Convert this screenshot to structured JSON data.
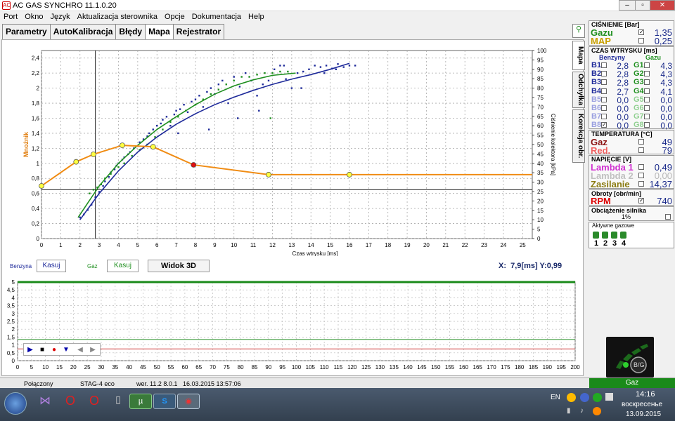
{
  "window": {
    "title": "AC GAS SYNCHRO  11.1.0.20",
    "icon_text": "AC"
  },
  "menu": [
    "Port",
    "Okno",
    "Język",
    "Aktualizacja sterownika",
    "Opcje",
    "Dokumentacja",
    "Help"
  ],
  "tabs": [
    "Parametry",
    "AutoKalibracja",
    "Błędy",
    "Mapa",
    "Rejestrator"
  ],
  "active_tab": "Mapa",
  "vtabs": [
    "Mapa",
    "Odchyłka",
    "Korekcja obr."
  ],
  "map_chart": {
    "ylabel_left": "Mnożnik",
    "ylabel_right": "Ciśnienie kolektora [kPa]",
    "xlabel": "Czas wtrysku [ms]",
    "y_ticks": [
      "0",
      "0,2",
      "0,4",
      "0,6",
      "0,8",
      "1",
      "1,2",
      "1,4",
      "1,6",
      "1,8",
      "2",
      "2,2",
      "2,4"
    ],
    "y2_ticks": [
      "0",
      "5",
      "10",
      "15",
      "20",
      "25",
      "30",
      "35",
      "40",
      "45",
      "50",
      "55",
      "60",
      "65",
      "70",
      "75",
      "80",
      "85",
      "90",
      "95",
      "100"
    ],
    "x_ticks": [
      "0",
      "1",
      "2",
      "3",
      "4",
      "5",
      "6",
      "7",
      "8",
      "9",
      "10",
      "11",
      "12",
      "13",
      "14",
      "15",
      "16",
      "17",
      "18",
      "19",
      "20",
      "21",
      "22",
      "23",
      "24",
      "25"
    ]
  },
  "chart_data": [
    {
      "type": "scatter",
      "xlabel": "Czas wtrysku [ms]",
      "ylabel": "Mnożnik",
      "y2label": "Ciśnienie kolektora [kPa]",
      "xlim": [
        0,
        25.5
      ],
      "ylim": [
        0,
        2.5
      ],
      "y2lim": [
        0,
        100
      ],
      "grid": true,
      "cursor": {
        "x": 2.8,
        "y": 0.65
      },
      "series": [
        {
          "name": "Benzyna",
          "color": "#1e2a9a",
          "kind": "points",
          "x": [
            2.0,
            2.2,
            2.4,
            2.6,
            2.8,
            3.0,
            3.2,
            3.3,
            3.5,
            3.6,
            3.8,
            3.9,
            4.0,
            4.2,
            4.3,
            4.5,
            4.6,
            4.8,
            5.0,
            5.1,
            5.3,
            5.5,
            5.6,
            5.8,
            6.0,
            6.2,
            6.3,
            6.5,
            6.7,
            6.9,
            7.0,
            7.2,
            7.4,
            7.6,
            7.8,
            8.0,
            8.2,
            8.4,
            8.6,
            8.8,
            9.0,
            9.2,
            9.4,
            9.7,
            10.0,
            10.3,
            10.6,
            10.9,
            11.2,
            11.5,
            11.8,
            12.1,
            12.4,
            12.7,
            13.0,
            13.3,
            13.6,
            13.9,
            14.2,
            14.5,
            14.8,
            15.1,
            15.4,
            15.7,
            16.0,
            16.3,
            7.1,
            8.7,
            10.2,
            11.3,
            12.6,
            13.5,
            14.7,
            15.3
          ],
          "y": [
            0.28,
            0.32,
            0.38,
            0.45,
            0.55,
            0.62,
            0.7,
            0.76,
            0.82,
            0.88,
            0.92,
            0.97,
            1.0,
            1.05,
            1.08,
            1.12,
            1.15,
            1.2,
            1.23,
            1.28,
            1.32,
            1.36,
            1.4,
            1.45,
            1.5,
            1.53,
            1.58,
            1.62,
            1.5,
            1.65,
            1.7,
            1.72,
            1.78,
            1.68,
            1.82,
            1.85,
            1.9,
            1.75,
            1.95,
            2.0,
            1.92,
            2.05,
            2.1,
            1.8,
            2.15,
            2.02,
            2.2,
            2.1,
            1.9,
            2.05,
            2.1,
            2.25,
            2.3,
            2.12,
            2.0,
            2.2,
            2.22,
            2.25,
            2.3,
            2.28,
            2.3,
            2.26,
            2.32,
            2.28,
            2.3,
            2.3,
            1.4,
            1.45,
            1.6,
            1.7,
            2.3,
            2.0,
            2.2,
            2.25
          ]
        },
        {
          "name": "Gaz",
          "color": "#1f8f1f",
          "kind": "points",
          "x": [
            2.5,
            2.7,
            2.9,
            3.1,
            3.3,
            3.6,
            4.0,
            4.3,
            4.7,
            5.1,
            5.5,
            5.9,
            6.3,
            6.7,
            7.1,
            7.5,
            8.0,
            8.4,
            8.8,
            9.2,
            9.6,
            10.0,
            10.4,
            10.8,
            11.2,
            11.6,
            12.0,
            12.4,
            12.8,
            11.9
          ],
          "y": [
            0.6,
            0.65,
            0.68,
            0.72,
            0.8,
            0.86,
            0.95,
            1.0,
            1.1,
            1.18,
            1.25,
            1.35,
            1.45,
            1.55,
            1.62,
            1.7,
            1.78,
            1.85,
            1.92,
            1.98,
            2.05,
            2.1,
            2.15,
            2.15,
            2.18,
            2.2,
            2.2,
            2.22,
            2.22,
            1.6
          ]
        },
        {
          "name": "Benzyna trend",
          "color": "#1e2a9a",
          "kind": "line",
          "x": [
            2.0,
            3.0,
            4.0,
            5.0,
            6.0,
            7.0,
            8.0,
            9.0,
            10.0,
            11.0,
            12.0,
            13.0,
            14.0,
            15.0,
            16.0
          ],
          "y": [
            0.25,
            0.6,
            0.9,
            1.15,
            1.35,
            1.52,
            1.66,
            1.78,
            1.88,
            1.97,
            2.05,
            2.12,
            2.18,
            2.25,
            2.33
          ]
        },
        {
          "name": "Gaz trend",
          "color": "#1f8f1f",
          "kind": "line",
          "x": [
            1.9,
            3.0,
            4.0,
            5.0,
            6.0,
            7.0,
            8.0,
            9.0,
            10.0,
            11.0,
            12.0,
            13.2
          ],
          "y": [
            0.28,
            0.7,
            1.0,
            1.24,
            1.45,
            1.62,
            1.78,
            1.92,
            2.03,
            2.11,
            2.17,
            2.2
          ]
        },
        {
          "name": "Mnożnik",
          "color": "#f08c14",
          "kind": "line",
          "x": [
            0,
            1.8,
            2.7,
            4.2,
            5.8,
            7.9,
            11.8,
            16.0,
            25.5
          ],
          "y": [
            0.7,
            1.02,
            1.12,
            1.24,
            1.22,
            0.98,
            0.85,
            0.85,
            0.85
          ],
          "markers": [
            0,
            1.8,
            2.7,
            4.2,
            5.8,
            7.9,
            11.8,
            16.0
          ],
          "selected_marker": 7.9
        }
      ]
    },
    {
      "type": "line",
      "xlim": [
        0,
        200
      ],
      "ylim": [
        0,
        5
      ],
      "y_ticks": [
        "0",
        "0,5",
        "1",
        "1,5",
        "2",
        "2,5",
        "3",
        "3,5",
        "4",
        "4,5",
        "5"
      ],
      "x_ticks": [
        "0",
        "5",
        "10",
        "15",
        "20",
        "25",
        "30",
        "35",
        "40",
        "45",
        "50",
        "55",
        "60",
        "65",
        "70",
        "75",
        "80",
        "85",
        "90",
        "95",
        "100",
        "105",
        "110",
        "115",
        "120",
        "125",
        "130",
        "135",
        "140",
        "145",
        "150",
        "155",
        "160",
        "165",
        "170",
        "175",
        "180",
        "185",
        "190",
        "195",
        "200"
      ],
      "grid": true,
      "series": [
        {
          "name": "top",
          "color": "#1a8a1a",
          "values_const": 5.0
        },
        {
          "name": "green",
          "color": "#3c9a3c",
          "values_const": 1.35
        },
        {
          "name": "red",
          "color": "#d04040",
          "values_const": 0.75
        }
      ]
    }
  ],
  "controls": {
    "benzyna_label": "Benzyna",
    "benzyna_kasuj": "Kasuj",
    "gaz_label": "Gaz",
    "gaz_kasuj": "Kasuj",
    "widok3d": "Widok 3D",
    "coord_x_label": "X:",
    "coord_x": "7,9[ms]",
    "coord_y_label": "Y:",
    "coord_y": "0,99"
  },
  "right": {
    "cisnienie_hdr": "CIŚNIENIE [Bar]",
    "gazu_label": "Gazu",
    "gazu_val": "1,35",
    "map_label": "MAP",
    "map_val": "0,25",
    "czas_hdr": "CZAS WTRYSKU [ms]",
    "benzyny_hdr": "Benzyny",
    "gazu_hdr": "Gazu",
    "injectors": [
      {
        "b": "B1",
        "bv": "2,8",
        "g": "G1",
        "gv": "4,3"
      },
      {
        "b": "B2",
        "bv": "2,8",
        "g": "G2",
        "gv": "4,3"
      },
      {
        "b": "B3",
        "bv": "2,8",
        "g": "G3",
        "gv": "4,3"
      },
      {
        "b": "B4",
        "bv": "2,7",
        "g": "G4",
        "gv": "4,1"
      },
      {
        "b": "B5",
        "bv": "0,0",
        "g": "G5",
        "gv": "0,0"
      },
      {
        "b": "B6",
        "bv": "0,0",
        "g": "G6",
        "gv": "0,0"
      },
      {
        "b": "B7",
        "bv": "0,0",
        "g": "G7",
        "gv": "0,0"
      },
      {
        "b": "B8",
        "bv": "0,0",
        "g": "G8",
        "gv": "0,0"
      }
    ],
    "temp_hdr": "TEMPERATURA  [°C]",
    "gaz_temp_label": "Gaz",
    "gaz_temp": "49",
    "red_label": "Red.",
    "red_temp": "79",
    "napiecie_hdr": "NAPIĘCIE [V]",
    "lambda1_label": "Lambda 1",
    "lambda1": "0,49",
    "lambda2_label": "Lambda 2",
    "lambda2": "0,00",
    "zasilanie_label": "Zasilanie",
    "zasilanie": "14,37",
    "obroty_hdr": "Obroty [obr/min]",
    "rpm_label": "RPM",
    "rpm": "740",
    "obciazenie_hdr": "Obciążenie silnika",
    "obciazenie": "1%",
    "aktywne_hdr": "Aktywne gazowe",
    "aktywne": [
      "1",
      "2",
      "3",
      "4"
    ],
    "bg_label": "B/G",
    "gaz_status": "Gaz"
  },
  "status": {
    "connection": "Połączony",
    "device": "STAG-4 eco",
    "version": "wer. 11.2  8.0.1",
    "datetime": "16.03.2015 13:57:06"
  },
  "taskbar": {
    "lang": "EN",
    "time": "14:16",
    "day": "воскресенье",
    "date": "13.09.2015"
  }
}
